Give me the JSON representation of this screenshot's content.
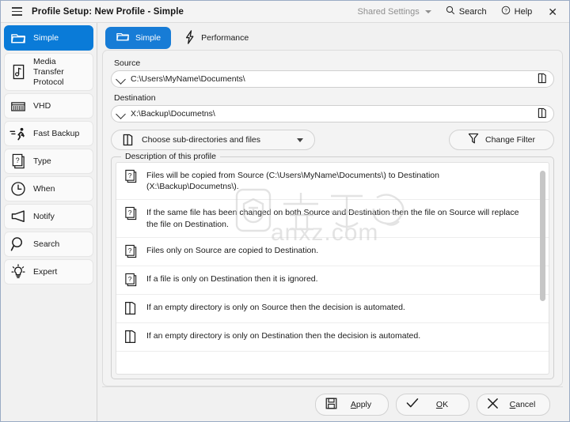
{
  "window": {
    "title": "Profile Setup: New Profile - Simple",
    "menu_icon": "hamburger-icon",
    "close_label": "✕"
  },
  "titlebar_actions": [
    {
      "label": "Shared Settings",
      "icon": "chevron-down-icon",
      "muted": true
    },
    {
      "label": "Search",
      "icon": "search-icon",
      "muted": false
    },
    {
      "label": "Help",
      "icon": "help-circle-icon",
      "muted": false
    }
  ],
  "sidebar": {
    "items": [
      {
        "label": "Simple",
        "icon": "folder-icon",
        "active": true
      },
      {
        "label": "Media Transfer Protocol",
        "icon": "music-file-icon",
        "active": false
      },
      {
        "label": "VHD",
        "icon": "drive-icon",
        "active": false
      },
      {
        "label": "Fast Backup",
        "icon": "running-man-icon",
        "active": false
      },
      {
        "label": "Type",
        "icon": "question-pages-icon",
        "active": false
      },
      {
        "label": "When",
        "icon": "clock-icon",
        "active": false
      },
      {
        "label": "Notify",
        "icon": "megaphone-icon",
        "active": false
      },
      {
        "label": "Search",
        "icon": "magnifier-icon",
        "active": false
      },
      {
        "label": "Expert",
        "icon": "lightbulb-icon",
        "active": false
      }
    ]
  },
  "tabs": [
    {
      "label": "Simple",
      "icon": "folder-icon",
      "active": true
    },
    {
      "label": "Performance",
      "icon": "lightning-bolt-icon",
      "active": false
    }
  ],
  "form": {
    "source_label": "Source",
    "source_value": "C:\\Users\\MyName\\Documents\\",
    "source_browse_icon": "open-folder-icon",
    "destination_label": "Destination",
    "destination_value": "X:\\Backup\\Documetns\\",
    "destination_browse_icon": "open-folder-icon",
    "choose_button": "Choose sub-directories and files",
    "choose_icon": "open-folder-icon",
    "filter_button": "Change Filter",
    "filter_icon": "funnel-icon"
  },
  "description": {
    "group_title": "Description of this profile",
    "rows": [
      {
        "icon": "question-pages-icon",
        "text": "Files will be copied from Source (C:\\Users\\MyName\\Documents\\) to Destination (X:\\Backup\\Documetns\\)."
      },
      {
        "icon": "question-pages-icon",
        "text": "If the same file has been changed on both Source and Destination then the file on Source will replace the file on Destination."
      },
      {
        "icon": "question-pages-icon",
        "text": "Files only on Source are copied to Destination."
      },
      {
        "icon": "question-pages-icon",
        "text": "If a file is only on Destination then it is ignored."
      },
      {
        "icon": "open-folder-icon",
        "text": "If an empty directory is only on Source then the decision is automated."
      },
      {
        "icon": "open-folder-icon",
        "text": "If an empty directory is only on Destination then the decision is automated."
      }
    ]
  },
  "footer": {
    "buttons": [
      {
        "label": "Apply",
        "icon": "save-icon",
        "accesskey": "A"
      },
      {
        "label": "OK",
        "icon": "check-icon",
        "accesskey": "O"
      },
      {
        "label": "Cancel",
        "icon": "close-icon",
        "accesskey": "C"
      }
    ]
  },
  "watermark": {
    "text": "anxz.com"
  },
  "colors": {
    "accent": "#0a7bd8",
    "tab_accent": "#177cd6",
    "window_bg": "#f1f1f1",
    "card_bg": "#f3f3f3",
    "list_bg": "#ffffff",
    "border": "#d2d2d2"
  }
}
